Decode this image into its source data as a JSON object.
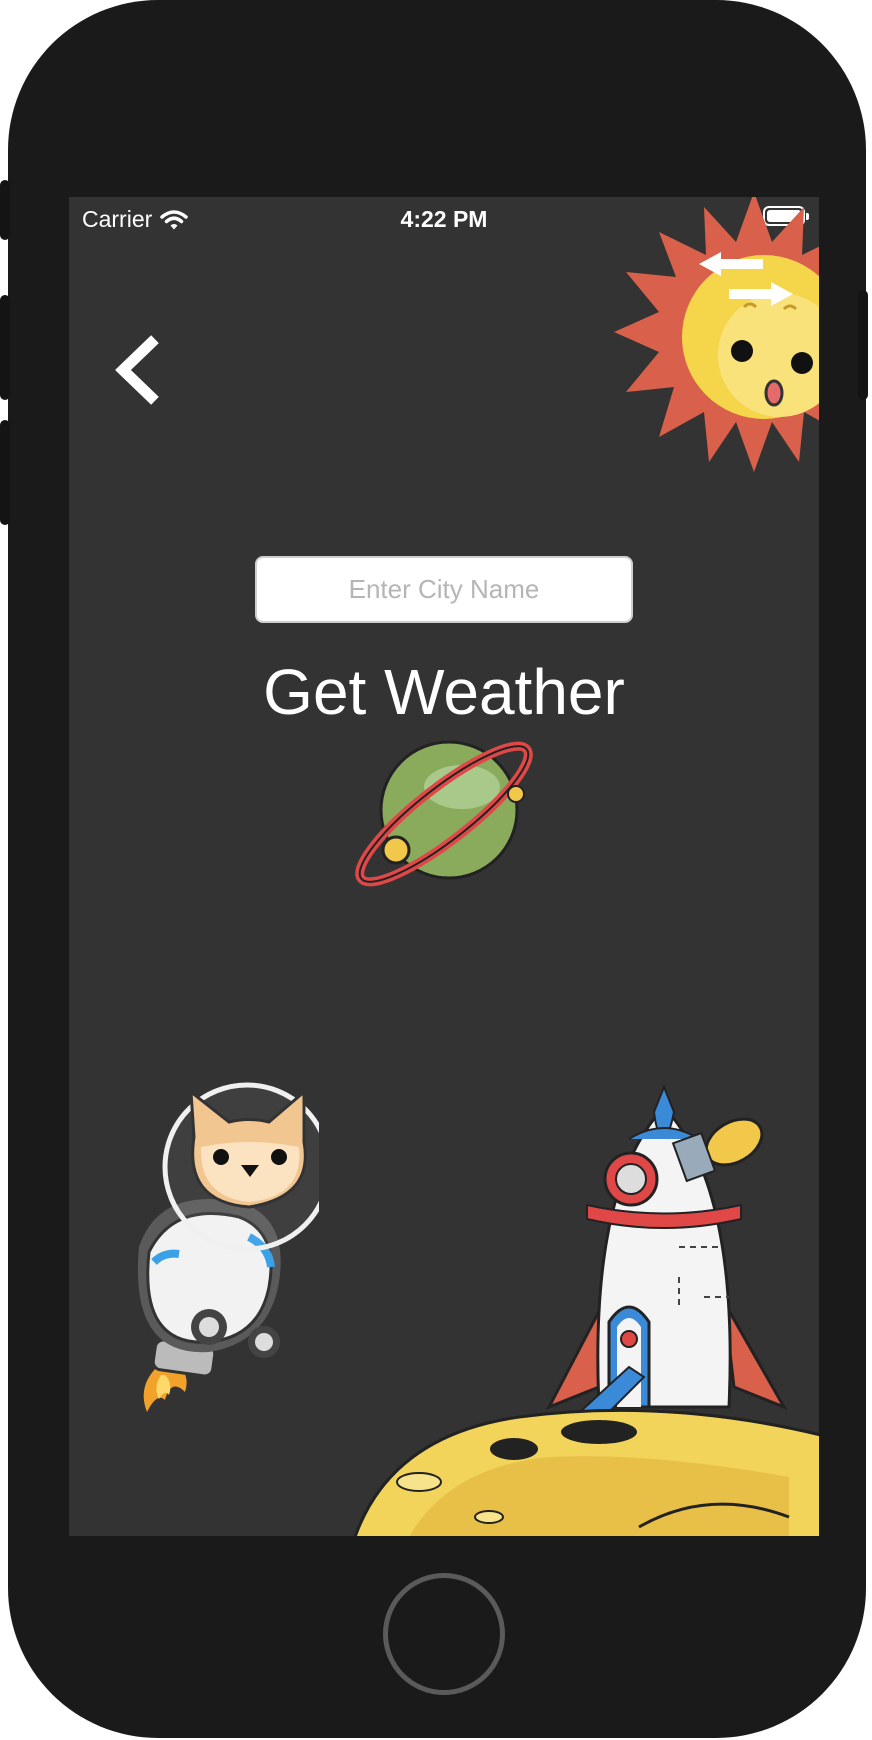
{
  "status_bar": {
    "carrier": "Carrier",
    "time": "4:22 PM",
    "wifi_icon": "wifi-icon",
    "battery_icon": "battery-full-icon"
  },
  "nav": {
    "back_icon": "chevron-left-icon",
    "switch_icon": "swap-arrows-icon"
  },
  "search": {
    "placeholder": "Enter City Name",
    "value": ""
  },
  "action": {
    "get_weather_label": "Get Weather"
  },
  "colors": {
    "background": "#333333",
    "device": "#1a1a1a",
    "text": "#ffffff",
    "sun_rays": "#d9604a",
    "sun_face": "#f5d64a",
    "planet": "#8aaa5c",
    "planet_ring": "#e04848",
    "moon": "#f2d45a"
  }
}
